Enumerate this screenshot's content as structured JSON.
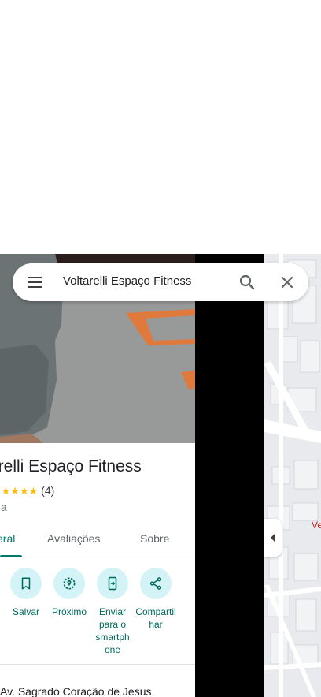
{
  "search": {
    "query": "Voltarelli Espaço Fitness"
  },
  "place": {
    "name": "arelli Espaço Fitness",
    "stars": "★★★★★",
    "review_count": "(4)",
    "category": "nia",
    "address": "Av. Sagrado Coração de Jesus,"
  },
  "tabs": {
    "overview": "eral",
    "reviews": "Avaliações",
    "about": "Sobre"
  },
  "actions": [
    {
      "label": "Salvar",
      "icon": "bookmark-icon"
    },
    {
      "label": "Próximo",
      "icon": "nearby-icon"
    },
    {
      "label": "Enviar para o smartph one",
      "icon": "send-to-phone-icon"
    },
    {
      "label": "Compartil har",
      "icon": "share-icon"
    }
  ],
  "map": {
    "label_fragment": "Ve"
  },
  "colors": {
    "accent": "#00796b",
    "action_bg": "#d4f3f7",
    "star": "#fbbc04"
  }
}
